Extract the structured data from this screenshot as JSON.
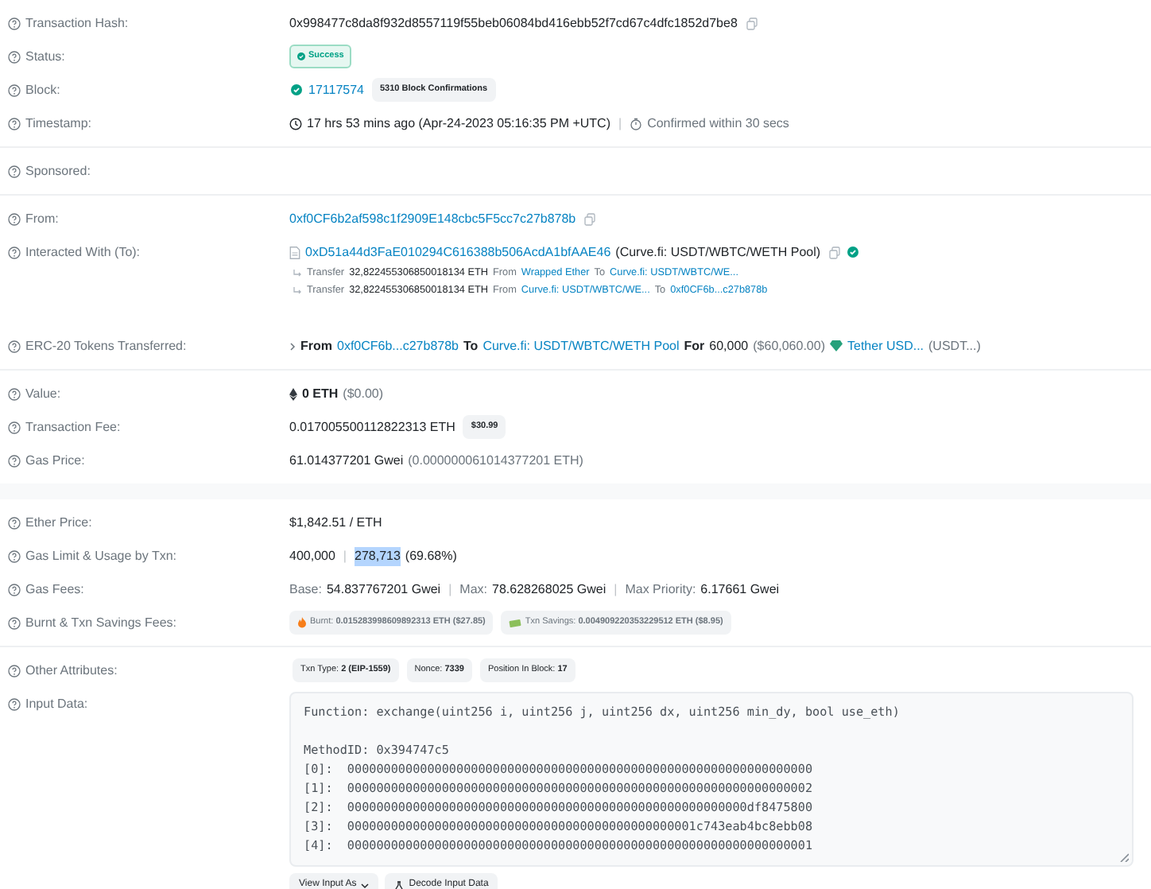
{
  "groups": [
    {
      "sections": [
        {
          "rows": [
            {
              "label": "Transaction Hash:",
              "lines": [
                {
                  "kind": "main",
                  "segments": [
                    {
                      "kind": "text",
                      "text": "0x998477c8da8f932d8557119f55beb06084bd416ebb52f7cd67c4dfc1852d7be8"
                    },
                    {
                      "kind": "copy"
                    }
                  ]
                }
              ]
            },
            {
              "label": "Status:",
              "lines": [
                {
                  "kind": "main",
                  "segments": [
                    {
                      "kind": "success",
                      "text": "Success"
                    }
                  ]
                }
              ]
            },
            {
              "label": "Block:",
              "lines": [
                {
                  "kind": "main",
                  "segments": [
                    {
                      "kind": "verified"
                    },
                    {
                      "kind": "link",
                      "text": "17117574"
                    },
                    {
                      "kind": "pill",
                      "text": "**5310 Block Confirmations**"
                    }
                  ]
                }
              ]
            },
            {
              "label": "Timestamp:",
              "lines": [
                {
                  "kind": "main",
                  "segments": [
                    {
                      "kind": "clock"
                    },
                    {
                      "kind": "text",
                      "text": "17 hrs 53 mins ago (Apr-24-2023 05:16:35 PM +UTC)"
                    },
                    {
                      "kind": "sep",
                      "text": "|"
                    },
                    {
                      "kind": "timer"
                    },
                    {
                      "kind": "muted",
                      "text": "Confirmed within 30 secs"
                    }
                  ]
                }
              ]
            }
          ]
        },
        {
          "rows": [
            {
              "label": "Sponsored:",
              "lines": []
            }
          ]
        },
        {
          "rows": [
            {
              "label": "From:",
              "lines": [
                {
                  "kind": "main",
                  "segments": [
                    {
                      "kind": "link",
                      "text": "0xf0CF6b2af598c1f2909E148cbc5F5cc7c27b878b"
                    },
                    {
                      "kind": "copy"
                    }
                  ]
                }
              ]
            },
            {
              "label": "Interacted With (To):",
              "lines": [
                {
                  "kind": "main",
                  "segments": [
                    {
                      "kind": "contract"
                    },
                    {
                      "kind": "link",
                      "text": "0xD51a44d3FaE010294C616388b506AcdA1bfAAE46"
                    },
                    {
                      "kind": "text",
                      "text": "(Curve.fi: USDT/WBTC/WETH Pool)"
                    },
                    {
                      "kind": "copy"
                    },
                    {
                      "kind": "verified"
                    }
                  ]
                },
                {
                  "kind": "sub",
                  "segments": [
                    {
                      "kind": "sub-arrow"
                    },
                    {
                      "kind": "muted",
                      "text": "Transfer"
                    },
                    {
                      "kind": "text",
                      "text": "32,822455306850018134 ETH"
                    },
                    {
                      "kind": "muted",
                      "text": "From"
                    },
                    {
                      "kind": "link",
                      "text": "Wrapped Ether"
                    },
                    {
                      "kind": "muted",
                      "text": "To"
                    },
                    {
                      "kind": "link",
                      "text": "Curve.fi: USDT/WBTC/WE..."
                    }
                  ]
                },
                {
                  "kind": "sub",
                  "segments": [
                    {
                      "kind": "sub-arrow"
                    },
                    {
                      "kind": "muted",
                      "text": "Transfer"
                    },
                    {
                      "kind": "text",
                      "text": "32,822455306850018134 ETH"
                    },
                    {
                      "kind": "muted",
                      "text": "From"
                    },
                    {
                      "kind": "link",
                      "text": "Curve.fi: USDT/WBTC/WE..."
                    },
                    {
                      "kind": "muted",
                      "text": "To"
                    },
                    {
                      "kind": "link",
                      "text": "0xf0CF6b...c27b878b"
                    }
                  ]
                }
              ]
            },
            {
              "label": "ERC-20 Tokens Transferred:",
              "lines": [
                {
                  "kind": "main",
                  "segments": [
                    {
                      "kind": "chevron"
                    },
                    {
                      "kind": "bold",
                      "text": "From"
                    },
                    {
                      "kind": "link",
                      "text": "0xf0CF6b...c27b878b"
                    },
                    {
                      "kind": "bold",
                      "text": "To"
                    },
                    {
                      "kind": "link",
                      "text": "Curve.fi: USDT/WBTC/WETH Pool"
                    },
                    {
                      "kind": "bold",
                      "text": "For"
                    },
                    {
                      "kind": "text",
                      "text": "60,000"
                    },
                    {
                      "kind": "muted",
                      "text": "($60,060.00)"
                    },
                    {
                      "kind": "gem"
                    },
                    {
                      "kind": "link",
                      "text": "Tether USD..."
                    },
                    {
                      "kind": "muted",
                      "text": "(USDT...)"
                    }
                  ]
                }
              ]
            }
          ]
        },
        {
          "rows": [
            {
              "label": "Value:",
              "lines": [
                {
                  "kind": "main",
                  "segments": [
                    {
                      "kind": "eth"
                    },
                    {
                      "kind": "bold",
                      "text": "0 ETH"
                    },
                    {
                      "kind": "muted",
                      "text": "($0.00)"
                    }
                  ]
                }
              ]
            },
            {
              "label": "Transaction Fee:",
              "lines": [
                {
                  "kind": "main",
                  "segments": [
                    {
                      "kind": "text",
                      "text": "0.017005500112822313 ETH"
                    },
                    {
                      "kind": "pill",
                      "text": "**$30.99**"
                    }
                  ]
                }
              ]
            },
            {
              "label": "Gas Price:",
              "lines": [
                {
                  "kind": "main",
                  "segments": [
                    {
                      "kind": "text",
                      "text": "61.014377201 Gwei"
                    },
                    {
                      "kind": "muted",
                      "text": "(0.000000061014377201 ETH)"
                    }
                  ]
                }
              ]
            }
          ]
        }
      ]
    },
    {
      "sections": [
        {
          "rows": [
            {
              "label": "Ether Price:",
              "lines": [
                {
                  "kind": "main",
                  "segments": [
                    {
                      "kind": "text",
                      "text": "$1,842.51 / ETH"
                    }
                  ]
                }
              ]
            },
            {
              "label": "Gas Limit & Usage by Txn:",
              "lines": [
                {
                  "kind": "main",
                  "segments": [
                    {
                      "kind": "text",
                      "text": "400,000"
                    },
                    {
                      "kind": "sep",
                      "text": "|"
                    },
                    {
                      "kind": "highlight",
                      "text": "278,713"
                    },
                    {
                      "kind": "text",
                      "text": "(69.68%)"
                    }
                  ]
                }
              ]
            },
            {
              "label": "Gas Fees:",
              "lines": [
                {
                  "kind": "main",
                  "segments": [
                    {
                      "kind": "muted",
                      "text": "Base:"
                    },
                    {
                      "kind": "text",
                      "text": "54.837767201 Gwei"
                    },
                    {
                      "kind": "sep",
                      "text": "|"
                    },
                    {
                      "kind": "muted",
                      "text": "Max:"
                    },
                    {
                      "kind": "text",
                      "text": "78.628268025 Gwei"
                    },
                    {
                      "kind": "sep",
                      "text": "|"
                    },
                    {
                      "kind": "muted",
                      "text": "Max Priority:"
                    },
                    {
                      "kind": "text",
                      "text": "6.17661 Gwei"
                    }
                  ]
                }
              ]
            },
            {
              "label": "Burnt & Txn Savings Fees:",
              "lines": [
                {
                  "kind": "main",
                  "segments": [
                    {
                      "kind": "fire-pill",
                      "text": "Burnt: **0.015283998609892313 ETH ($27.85)**"
                    },
                    {
                      "kind": "savings-pill",
                      "text": "Txn Savings: **0.004909220353229512 ETH ($8.95)**"
                    }
                  ]
                }
              ]
            }
          ]
        },
        {
          "rows": [
            {
              "label": "Other Attributes:",
              "lines": [
                {
                  "kind": "main",
                  "segments": [
                    {
                      "kind": "pill",
                      "text": "Txn Type: **2 (EIP-1559)**"
                    },
                    {
                      "kind": "pill",
                      "text": "Nonce: **7339**"
                    },
                    {
                      "kind": "pill",
                      "text": "Position In Block: **17**"
                    }
                  ]
                }
              ]
            },
            {
              "label": "Input Data:",
              "lines": [
                {
                  "kind": "code",
                  "blocks": [
                    {
                      "text": [
                        "Function: exchange(uint256 i, uint256 j, uint256 dx, uint256 min_dy, bool use_eth)"
                      ]
                    },
                    {
                      "text": [
                        "MethodID: 0x394747c5",
                        "[0]:  0000000000000000000000000000000000000000000000000000000000000000",
                        "[1]:  0000000000000000000000000000000000000000000000000000000000000002",
                        "[2]:  0000000000000000000000000000000000000000000000000000000df8475800",
                        "[3]:  000000000000000000000000000000000000000000000001c743eab4bc8ebb08",
                        "[4]:  0000000000000000000000000000000000000000000000000000000000000001"
                      ]
                    }
                  ]
                },
                {
                  "kind": "buttons",
                  "segments": [
                    {
                      "kind": "dropdown-button",
                      "text": "View Input As"
                    },
                    {
                      "kind": "decode-button",
                      "text": "Decode Input Data"
                    }
                  ]
                }
              ]
            }
          ]
        }
      ]
    }
  ]
}
